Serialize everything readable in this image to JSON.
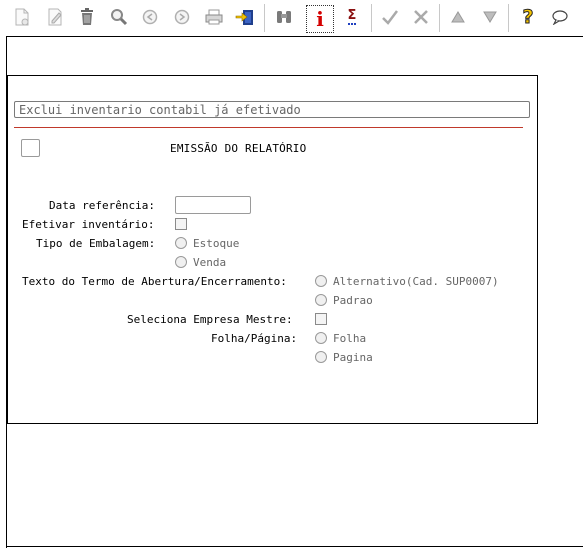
{
  "toolbar": {
    "icons": [
      "new-icon",
      "edit-icon",
      "delete-icon",
      "search-icon",
      "previous-icon",
      "next-icon",
      "print-icon",
      "export-icon",
      "binoculars-icon",
      "info-icon",
      "sum-icon",
      "confirm-icon",
      "cancel-icon",
      "first-icon",
      "last-icon",
      "help-icon",
      "chat-icon"
    ],
    "info_glyph": "i",
    "sum_glyph": "Σ",
    "help_glyph": "?"
  },
  "form": {
    "title": "Exclui inventario contabil já efetivado",
    "heading": "EMISSÃO DO RELATÓRIO",
    "data_referencia_label": "Data referência:",
    "data_referencia_value": "",
    "efetivar_label": "Efetivar inventário:",
    "tipo_embalagem_label": "Tipo de Embalagem:",
    "tipo_embalagem_options": [
      "Estoque",
      "Venda"
    ],
    "texto_termo_label": "Texto do Termo de Abertura/Encerramento:",
    "texto_termo_options": [
      "Alternativo(Cad. SUP0007)",
      "Padrao"
    ],
    "seleciona_empresa_label": "Seleciona Empresa Mestre:",
    "folha_pagina_label": "Folha/Página:",
    "folha_pagina_options": [
      "Folha",
      "Pagina"
    ]
  },
  "colors": {
    "red_rule": "#c0392b",
    "info_red": "#d40000",
    "help_yellow": "#f5c400"
  }
}
